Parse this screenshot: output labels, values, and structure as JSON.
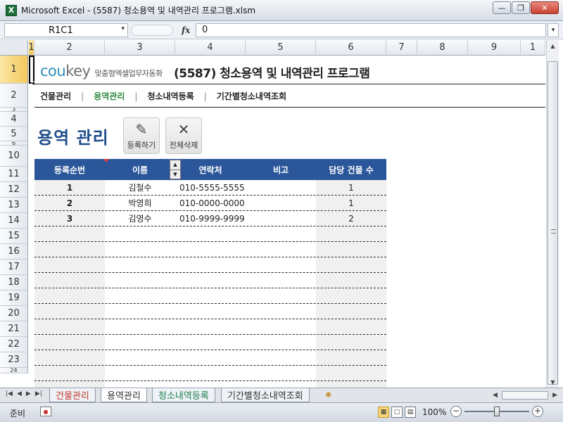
{
  "window": {
    "title": "Microsoft Excel - (5587) 청소용역 및 내역관리 프로그램.xlsm",
    "app_icon": "X",
    "minimize_icon": "—",
    "restore_icon": "❐",
    "close_icon": "✕"
  },
  "formula_bar": {
    "name_box": "R1C1",
    "name_box_arrow": "▾",
    "fx_label": "fx",
    "value": "0",
    "expand_icon": "▾"
  },
  "column_headers": [
    "1",
    "2",
    "3",
    "4",
    "5",
    "6",
    "7",
    "8",
    "9",
    "1"
  ],
  "row_headers": [
    "1",
    "2",
    "3",
    "4",
    "5",
    "6",
    "10",
    "11",
    "12",
    "13",
    "14",
    "15",
    "16",
    "17",
    "18",
    "19",
    "20",
    "21",
    "22",
    "23",
    "24"
  ],
  "sheet": {
    "brand_logo_cou": "cou",
    "brand_logo_key": "key",
    "brand_tagline": "맞춤형엑셀업무자동화",
    "doc_title": "(5587) 청소용역 및 내역관리 프로그램",
    "nav": [
      "건물관리",
      "용역관리",
      "청소내역등록",
      "기간별청소내역조회"
    ],
    "nav_separator": "|",
    "active_nav": "용역관리",
    "page_heading": "용역 관리",
    "actions": [
      {
        "label": "등록하기",
        "icon": "✎"
      },
      {
        "label": "전체삭제",
        "icon": "✕"
      }
    ],
    "table": {
      "headers": [
        "등록순번",
        "이름",
        "연락처",
        "비고",
        "담당 건물 수"
      ],
      "rows": [
        [
          "1",
          "김철수",
          "010-5555-5555",
          "",
          "1"
        ],
        [
          "2",
          "박영희",
          "010-0000-0000",
          "",
          "1"
        ],
        [
          "3",
          "김영수",
          "010-9999-9999",
          "",
          "2"
        ],
        [
          "",
          "",
          "",
          "",
          ""
        ],
        [
          "",
          "",
          "",
          "",
          ""
        ],
        [
          "",
          "",
          "",
          "",
          ""
        ],
        [
          "",
          "",
          "",
          "",
          ""
        ],
        [
          "",
          "",
          "",
          "",
          ""
        ],
        [
          "",
          "",
          "",
          "",
          ""
        ],
        [
          "",
          "",
          "",
          "",
          ""
        ],
        [
          "",
          "",
          "",
          "",
          ""
        ],
        [
          "",
          "",
          "",
          "",
          ""
        ],
        [
          "",
          "",
          "",
          "",
          ""
        ],
        [
          "",
          "",
          "",
          "",
          ""
        ]
      ],
      "spinner_up": "▲",
      "spinner_down": "▼"
    }
  },
  "sheet_tabs": {
    "tabs": [
      "건물관리",
      "용역관리",
      "청소내역등록",
      "기간별청소내역조회"
    ],
    "active": "용역관리",
    "nav_arrows": [
      "|◀",
      "◀",
      "▶",
      "▶|"
    ],
    "new_sheet_icon": "✱"
  },
  "status_bar": {
    "ready": "준비",
    "zoom": "100%",
    "zoom_minus": "−",
    "zoom_plus": "+"
  },
  "colors": {
    "header_blue": "#2b579a",
    "heading_blue": "#1f4e8c",
    "active_nav_green": "#2e8b3d",
    "brand_cyan": "#2d8fb5"
  }
}
